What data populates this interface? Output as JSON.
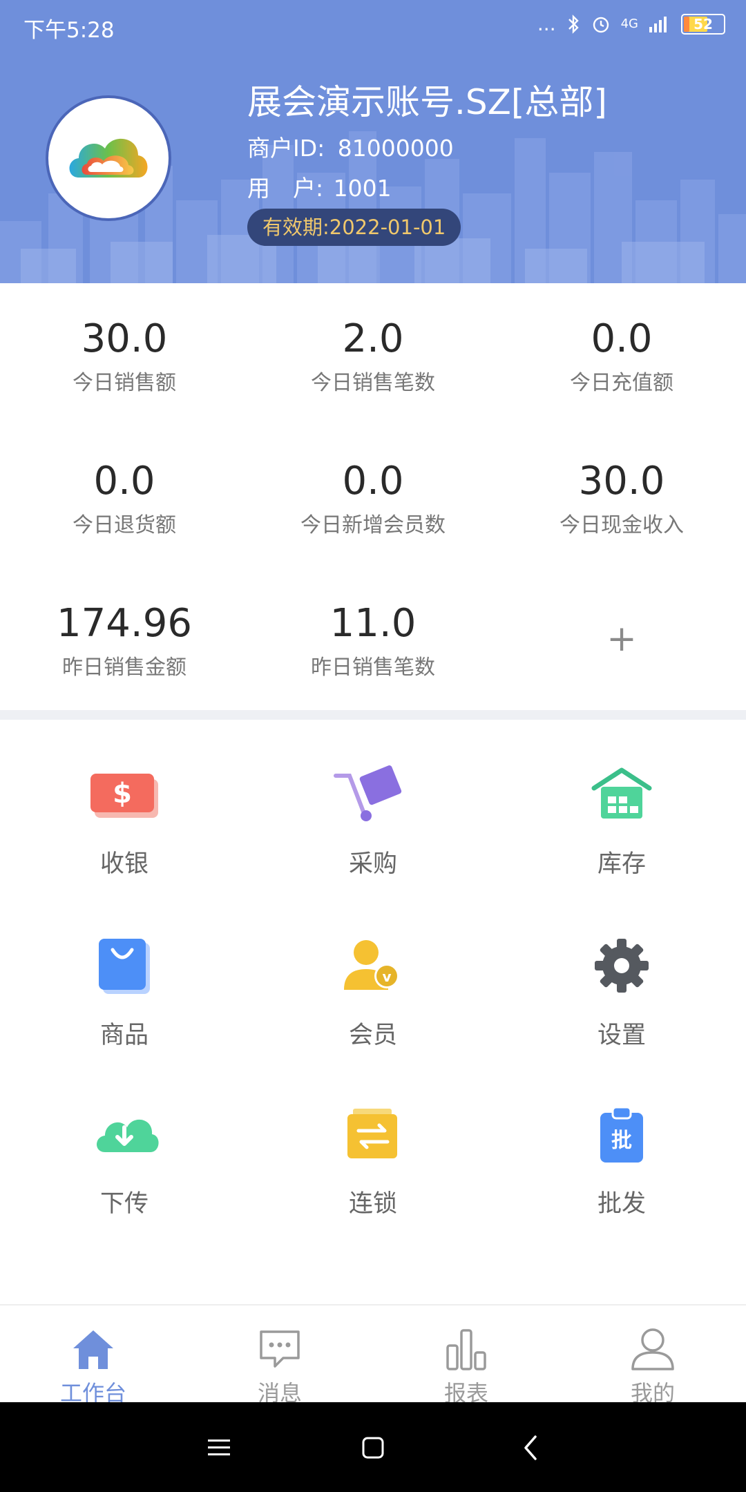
{
  "status_bar": {
    "time": "下午5:28",
    "dots": "...",
    "network": "4G",
    "battery": "52"
  },
  "account": {
    "name": "展会演示账号.SZ[总部]",
    "merchant_id_label": "商户ID:",
    "merchant_id": "81000000",
    "user_label": "用　户:",
    "user": "1001",
    "validity_label": "有效期:",
    "validity_date": "2022-01-01"
  },
  "stats": [
    {
      "value": "30.0",
      "label": "今日销售额"
    },
    {
      "value": "2.0",
      "label": "今日销售笔数"
    },
    {
      "value": "0.0",
      "label": "今日充值额"
    },
    {
      "value": "0.0",
      "label": "今日退货额"
    },
    {
      "value": "0.0",
      "label": "今日新增会员数"
    },
    {
      "value": "30.0",
      "label": "今日现金收入"
    },
    {
      "value": "174.96",
      "label": "昨日销售金额"
    },
    {
      "value": "11.0",
      "label": "昨日销售笔数"
    }
  ],
  "add_stat": "+",
  "grid": [
    {
      "label": "收银",
      "icon": "cashier-icon"
    },
    {
      "label": "采购",
      "icon": "purchase-cart-icon"
    },
    {
      "label": "库存",
      "icon": "warehouse-icon"
    },
    {
      "label": "商品",
      "icon": "shopping-bag-icon"
    },
    {
      "label": "会员",
      "icon": "member-vip-icon"
    },
    {
      "label": "设置",
      "icon": "gear-icon"
    },
    {
      "label": "下传",
      "icon": "cloud-download-icon"
    },
    {
      "label": "连锁",
      "icon": "chain-transfer-icon"
    },
    {
      "label": "批发",
      "icon": "wholesale-clipboard-icon"
    }
  ],
  "bottom_nav": [
    {
      "label": "工作台",
      "icon": "home-icon",
      "active": true
    },
    {
      "label": "消息",
      "icon": "message-icon",
      "active": false
    },
    {
      "label": "报表",
      "icon": "bar-chart-icon",
      "active": false
    },
    {
      "label": "我的",
      "icon": "user-icon",
      "active": false
    }
  ],
  "colors": {
    "header": "#6f8fdb",
    "validity_bg": "#33467a",
    "validity_text": "#f0c86c",
    "active_nav": "#6f8fdb"
  }
}
